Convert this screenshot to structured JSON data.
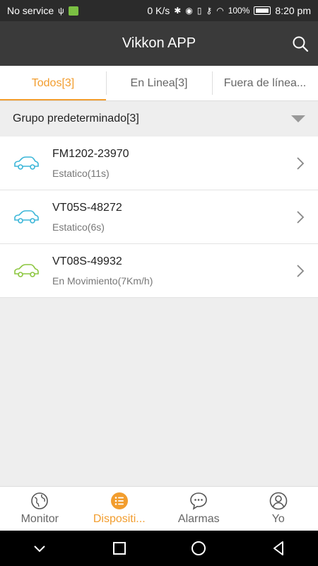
{
  "status_bar": {
    "carrier": "No service",
    "speed": "0 K/s",
    "battery": "100%",
    "time": "8:20 pm"
  },
  "app_bar": {
    "title": "Vikkon APP",
    "search_icon": "search-icon"
  },
  "tabs": [
    {
      "label": "Todos[3]",
      "active": true
    },
    {
      "label": "En Linea[3]",
      "active": false
    },
    {
      "label": "Fuera de línea...",
      "active": false
    }
  ],
  "group": {
    "label": "Grupo predeterminado[3]"
  },
  "devices": [
    {
      "name": "FM1202-23970",
      "status": "Estatico(11s)",
      "color": "#3bb6d8"
    },
    {
      "name": "VT05S-48272",
      "status": "Estatico(6s)",
      "color": "#3bb6d8"
    },
    {
      "name": "VT08S-49932",
      "status": "En Movimiento(7Km/h)",
      "color": "#8cc63f"
    }
  ],
  "bottom_nav": [
    {
      "label": "Monitor",
      "icon": "globe-icon",
      "active": false
    },
    {
      "label": "Dispositi...",
      "icon": "list-icon",
      "active": true
    },
    {
      "label": "Alarmas",
      "icon": "chat-icon",
      "active": false
    },
    {
      "label": "Yo",
      "icon": "user-icon",
      "active": false
    }
  ],
  "colors": {
    "accent": "#f29d2e",
    "app_bar": "#3a3a3a",
    "static_car": "#3bb6d8",
    "moving_car": "#8cc63f"
  }
}
